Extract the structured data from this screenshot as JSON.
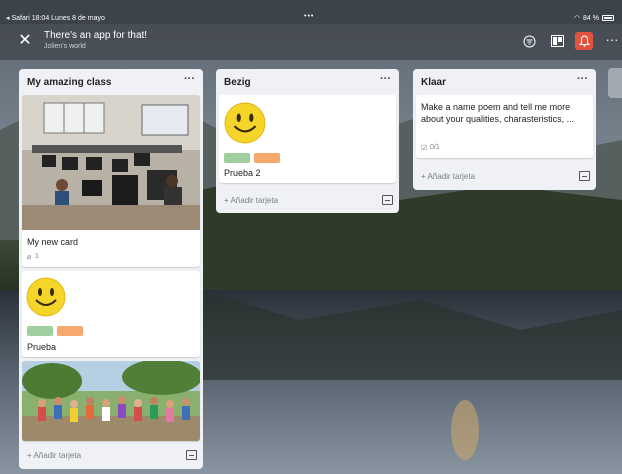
{
  "status_bar": {
    "left": "◂ Safari  18:04  Lunes 8 de mayo",
    "dots": "•••",
    "battery": "84 %"
  },
  "header": {
    "title": "There's an app for that!",
    "subtitle": "Jolien's world",
    "close_icon": "close-icon",
    "icons": [
      "filter-icon",
      "board-icon",
      "bell-icon",
      "more-icon"
    ],
    "more": "···"
  },
  "lists": [
    {
      "name": "My amazing class",
      "menu": "···",
      "cards": [
        {
          "title": "My new card",
          "attachments": "1",
          "image": "classroom-photo"
        },
        {
          "title": "Prueba",
          "labels": [
            "#9fcf9c",
            "#f6a96c"
          ],
          "image": "smiley"
        },
        {
          "image": "group-photo"
        }
      ],
      "add_card": "+ Añadir tarjeta"
    },
    {
      "name": "Bezig",
      "menu": "···",
      "cards": [
        {
          "title": "Prueba 2",
          "labels": [
            "#9fcf9c",
            "#f6a96c"
          ],
          "image": "smiley"
        }
      ],
      "add_card": "+ Añadir tarjeta"
    },
    {
      "name": "Klaar",
      "menu": "···",
      "cards": [
        {
          "title": "Make a name poem and tell me more about your qualities, charasteristics, ...",
          "checklist": "0/1"
        }
      ],
      "add_card": "+ Añadir tarjeta"
    }
  ],
  "colors": {
    "accent_bell": "#e0533f",
    "label_green": "#9fcf9c",
    "label_orange": "#f6a96c",
    "list_bg": "#eff1f4"
  }
}
